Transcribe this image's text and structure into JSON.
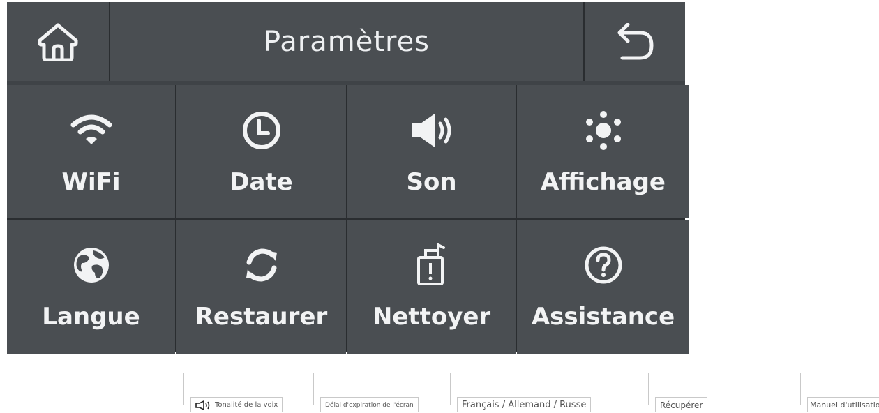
{
  "header": {
    "title": "Paramètres",
    "home_icon": "home-icon",
    "back_icon": "back-arrow-icon"
  },
  "tiles": [
    {
      "label": "WiFi",
      "icon": "wifi-icon"
    },
    {
      "label": "Date",
      "icon": "clock-icon"
    },
    {
      "label": "Son",
      "icon": "speaker-icon"
    },
    {
      "label": "Affichage",
      "icon": "brightness-icon"
    },
    {
      "label": "Langue",
      "icon": "globe-icon"
    },
    {
      "label": "Restaurer",
      "icon": "restore-icon"
    },
    {
      "label": "Nettoyer",
      "icon": "clean-icon"
    },
    {
      "label": "Assistance",
      "icon": "help-icon"
    }
  ],
  "callouts": [
    {
      "text": "Tonalité de la voix",
      "icon": "speaker-outline-icon"
    },
    {
      "text": "Délai d'expiration de l'écran"
    },
    {
      "text": "Français / Allemand / Russe"
    },
    {
      "text": "Récupérer"
    },
    {
      "text": "Manuel d'utilisation"
    }
  ],
  "colors": {
    "screen_bg": "#3f4347",
    "tile_bg": "#4a4e52",
    "grid_lines": "#2a2d30",
    "icon_text": "#f2f3f4"
  }
}
